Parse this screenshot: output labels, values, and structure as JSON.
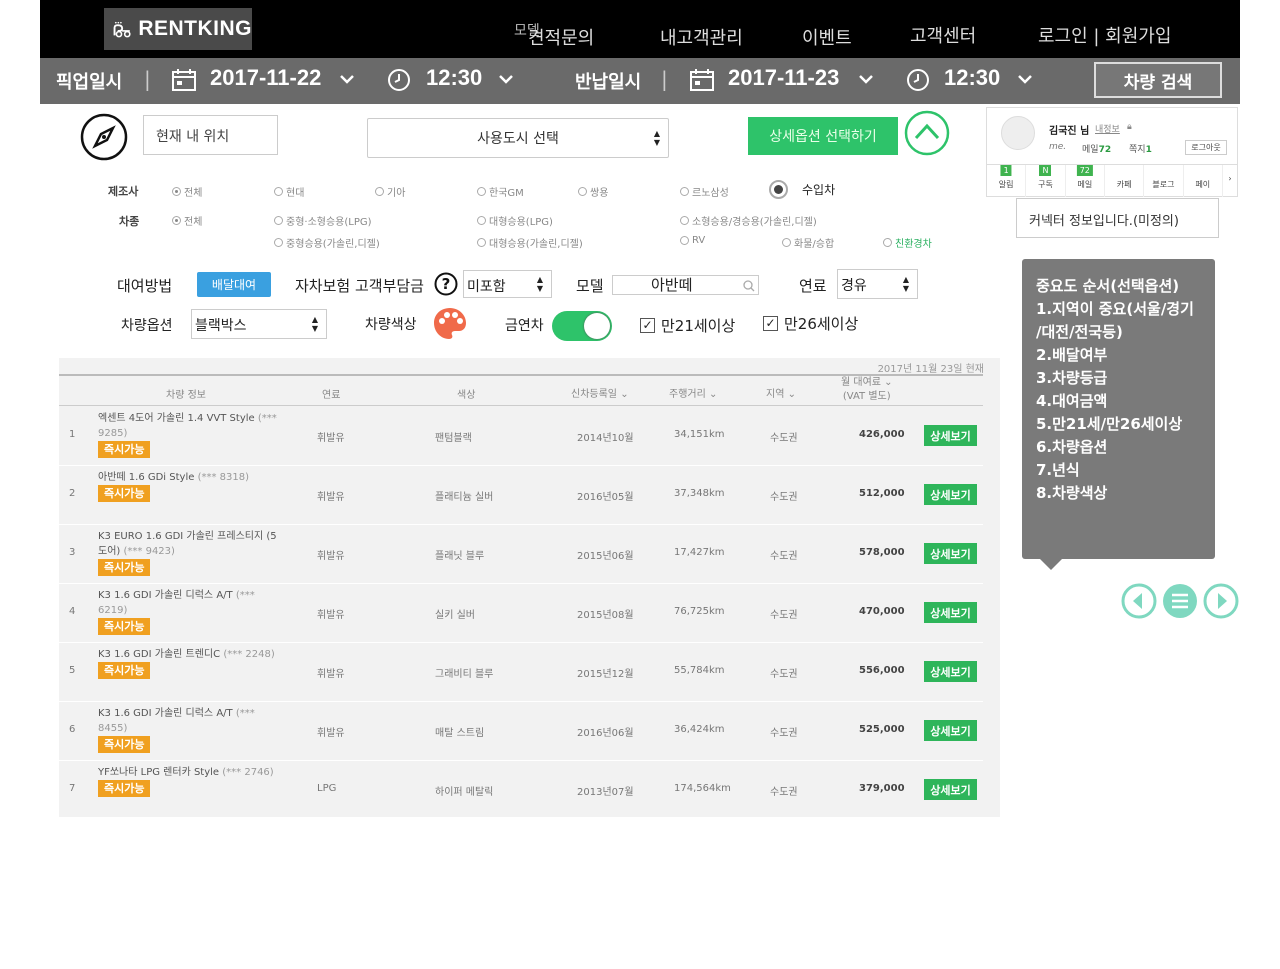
{
  "header": {
    "logo_text": "RENTKING",
    "tiny_overlay": "모델",
    "nav": [
      "견적문의",
      "내고객관리",
      "이벤트",
      "고객센터",
      "로그인 | 회원가입"
    ]
  },
  "datebar": {
    "pickup_label": "픽업일시",
    "pickup_date": "2017-11-22",
    "pickup_time": "12:30",
    "return_label": "반납일시",
    "return_date": "2017-11-23",
    "return_time": "12:30",
    "search_label": "차량 검색",
    "separator": "|"
  },
  "search": {
    "location_placeholder": "현재 내 위치",
    "city_select": "사용도시 선택",
    "detail_button": "상세옵션 선택하기"
  },
  "filters": {
    "maker_label": "제조사",
    "makers": [
      "전체",
      "현대",
      "기아",
      "한국GM",
      "쌍용",
      "르노삼성"
    ],
    "imported_label": "수입차",
    "type_label": "차종",
    "types_row1": [
      "전체",
      "중형·소형승용(LPG)",
      "대형승용(LPG)",
      "소형승용/경승용(가솔린,디젤)"
    ],
    "types_row2": [
      "중형승용(가솔린,디젤)",
      "대형승용(가솔린,디젤)",
      "RV",
      "화물/승합",
      "친환경차"
    ]
  },
  "options": {
    "rental_method_label": "대여방법",
    "delivery_button": "배달대여",
    "insurance_label": "자차보험 고객부담금",
    "insurance_value": "미포함",
    "model_label": "모델",
    "model_value": "아반떼",
    "fuel_label": "연료",
    "fuel_value": "경유",
    "car_option_label": "차량옵션",
    "car_option_value": "블랙박스",
    "color_label": "차량색상",
    "non_smoking_label": "금연차",
    "age21_label": "만21세이상",
    "age26_label": "만26세이상"
  },
  "table": {
    "as_of": "2017년 11월 23일 현재",
    "headers": {
      "info": "차량 정보",
      "fuel": "연료",
      "color": "색상",
      "reg": "신차등록일",
      "mileage": "주행거리",
      "region": "지역",
      "price": "월 대여료",
      "price_note": "(VAT 별도)"
    },
    "badge_label": "즉시가능",
    "detail_label": "상세보기",
    "rows": [
      {
        "no": "1",
        "name": "엑센트 4도어 가솔린 1.4 VVT Style",
        "code": "(*** 9285)",
        "fuel": "휘발유",
        "color": "팬텀블랙",
        "reg": "2014년10월",
        "mileage": "34,151km",
        "region": "수도권",
        "price": "426,000"
      },
      {
        "no": "2",
        "name": "아반떼 1.6 GDi Style",
        "code": "(*** 8318)",
        "fuel": "휘발유",
        "color": "플래티늄 실버",
        "reg": "2016년05월",
        "mileage": "37,348km",
        "region": "수도권",
        "price": "512,000"
      },
      {
        "no": "3",
        "name": "K3 EURO 1.6 GDI 가솔린 프레스티지 (5도어)",
        "code": "(*** 9423)",
        "fuel": "휘발유",
        "color": "플래닛 블루",
        "reg": "2015년06월",
        "mileage": "17,427km",
        "region": "수도권",
        "price": "578,000"
      },
      {
        "no": "4",
        "name": "K3 1.6 GDI 가솔린 디럭스 A/T",
        "code": "(*** 6219)",
        "fuel": "휘발유",
        "color": "실키 실버",
        "reg": "2015년08월",
        "mileage": "76,725km",
        "region": "수도권",
        "price": "470,000"
      },
      {
        "no": "5",
        "name": "K3 1.6 GDI 가솔린 트렌디C",
        "code": "(*** 2248)",
        "fuel": "휘발유",
        "color": "그래비티 블루",
        "reg": "2015년12월",
        "mileage": "55,784km",
        "region": "수도권",
        "price": "556,000"
      },
      {
        "no": "6",
        "name": "K3 1.6 GDI 가솔린 디럭스 A/T",
        "code": "(*** 8455)",
        "fuel": "휘발유",
        "color": "매탈 스트림",
        "reg": "2016년06월",
        "mileage": "36,424km",
        "region": "수도권",
        "price": "525,000"
      },
      {
        "no": "7",
        "name": "YF쏘나타 LPG 렌터카 Style",
        "code": "(*** 2746)",
        "fuel": "LPG",
        "color": "하이퍼 메탈릭",
        "reg": "2013년07월",
        "mileage": "174,564km",
        "region": "수도권",
        "price": "379,000"
      }
    ]
  },
  "profile": {
    "name": "김국진 님",
    "my_info": "내정보",
    "me": "me.",
    "mail_label": "메일",
    "mail_count": "72",
    "note_label": "쪽지",
    "note_count": "1",
    "logout": "로그아웃",
    "tabs": [
      {
        "label": "알림",
        "badge": "1"
      },
      {
        "label": "구독",
        "badge": "N"
      },
      {
        "label": "메일",
        "badge": "72"
      },
      {
        "label": "카페",
        "badge": ""
      },
      {
        "label": "블로그",
        "badge": ""
      },
      {
        "label": "페이",
        "badge": ""
      }
    ]
  },
  "connector_text": "커넥터 정보입니다.(미정의)",
  "tooltip_lines": [
    "중요도 순서(선택옵션)",
    "1.지역이 중요(서울/경기",
    "/대전/전국등)",
    "2.배달여부",
    "3.차량등급",
    "4.대여금액",
    "5.만21세/만26세이상",
    "6.차량옵션",
    "7.년식",
    "8.차량색상"
  ],
  "colors": {
    "accent_green": "#2ec36a",
    "delivery_blue": "#3aa0e0",
    "badge_orange": "#f0a020",
    "control_mint": "#7fd8c0"
  }
}
